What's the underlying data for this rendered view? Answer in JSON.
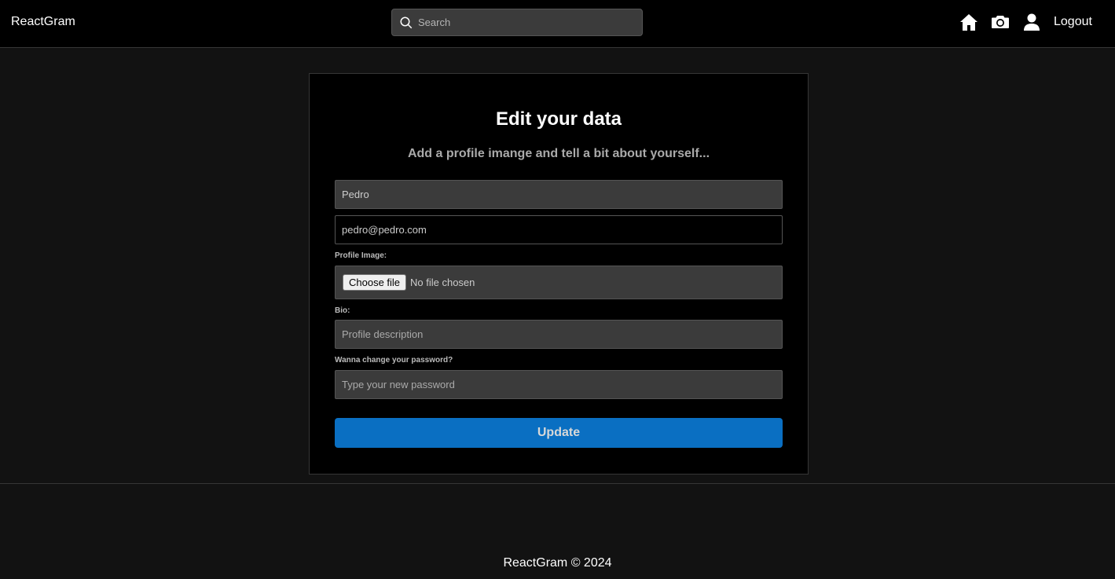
{
  "navbar": {
    "brand": "ReactGram",
    "search_placeholder": "Search",
    "icons": [
      "home-icon",
      "camera-icon",
      "user-icon"
    ],
    "logout_label": "Logout"
  },
  "form": {
    "title": "Edit your data",
    "subtitle": "Add a profile imange and tell a bit about yourself...",
    "name_value": "Pedro",
    "email_value": "pedro@pedro.com",
    "profile_image_label": "Profile Image:",
    "file_button_label": "Choose file",
    "file_status": "No file chosen",
    "bio_label": "Bio:",
    "bio_placeholder": "Profile description",
    "password_label": "Wanna change your password?",
    "password_placeholder": "Type your new password",
    "update_label": "Update"
  },
  "footer": {
    "text": "ReactGram © 2024"
  },
  "colors": {
    "background": "#121212",
    "navbar": "#000000",
    "accent": "#0a6fc2"
  }
}
